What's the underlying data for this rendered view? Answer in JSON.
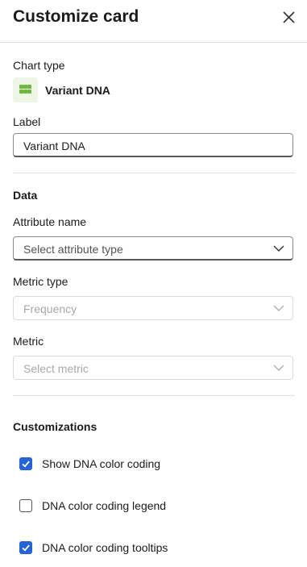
{
  "panel": {
    "title": "Customize card",
    "close_icon": "close-icon"
  },
  "chart_type": {
    "label": "Chart type",
    "icon": "grid-dots-icon",
    "icon_color": "#6fb83f",
    "value": "Variant DNA"
  },
  "label_field": {
    "label": "Label",
    "value": "Variant DNA"
  },
  "data_section": {
    "heading": "Data",
    "attribute_name": {
      "label": "Attribute name",
      "placeholder": "Select attribute type"
    },
    "metric_type": {
      "label": "Metric type",
      "placeholder": "Frequency",
      "disabled": true
    },
    "metric": {
      "label": "Metric",
      "placeholder": "Select metric",
      "disabled": true
    }
  },
  "customizations": {
    "heading": "Customizations",
    "accent": "#2563d6",
    "options": [
      {
        "label": "Show DNA color coding",
        "checked": true
      },
      {
        "label": "DNA color coding legend",
        "checked": false
      },
      {
        "label": "DNA color coding tooltips",
        "checked": true
      }
    ]
  }
}
